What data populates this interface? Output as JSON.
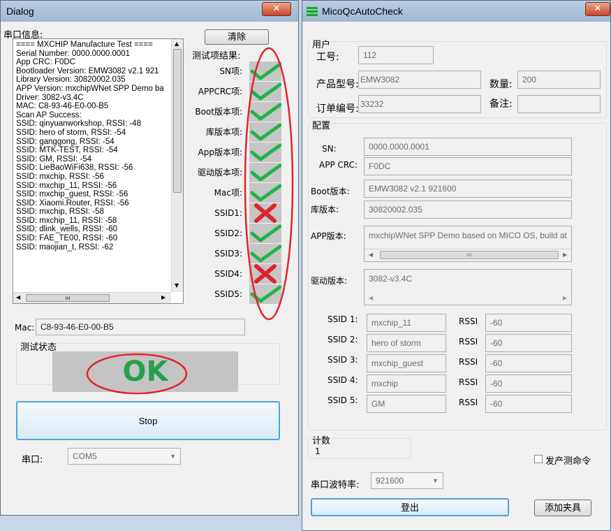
{
  "left": {
    "title": "Dialog",
    "serial_label": "串口信息:",
    "clear_button": "清除",
    "log_lines": [
      "==== MXCHIP Manufacture Test ====",
      "Serial Number: 0000.0000.0001",
      "App CRC: F0DC",
      "Bootloader Version: EMW3082 v2.1 921",
      "Library Version: 30820002.035",
      "APP Version: mxchipWNet SPP Demo ba",
      "Driver: 3082-v3.4C",
      "MAC: C8-93-46-E0-00-B5",
      "Scan AP Success:",
      "  SSID: qinyuanworkshop, RSSI: -48",
      "  SSID: hero of storm, RSSI: -54",
      "  SSID: ganggong, RSSI: -54",
      "  SSID: MTK-TEST, RSSI: -54",
      "  SSID: GM, RSSI: -54",
      "  SSID: LieBaoWiFi638, RSSI: -56",
      "  SSID: mxchip, RSSI: -56",
      "  SSID: mxchip_11, RSSI: -56",
      "  SSID: mxchip_guest, RSSI: -56",
      "  SSID: Xiaomi.Router, RSSI: -56",
      "  SSID: mxchip, RSSI: -58",
      "  SSID: mxchip_11, RSSI: -58",
      "  SSID: dlink_wells, RSSI: -60",
      "  SSID: FAE_TE00, RSSI: -60",
      "  SSID: maojian_t, RSSI: -62"
    ],
    "results_label": "测试项结果:",
    "results": [
      {
        "label": "SN项:",
        "pass": true
      },
      {
        "label": "APPCRC项:",
        "pass": true
      },
      {
        "label": "Boot版本项:",
        "pass": true
      },
      {
        "label": "库版本项:",
        "pass": true
      },
      {
        "label": "App版本项:",
        "pass": true
      },
      {
        "label": "驱动版本项:",
        "pass": true
      },
      {
        "label": "Mac项:",
        "pass": true
      },
      {
        "label": "SSID1:",
        "pass": false
      },
      {
        "label": "SSID2:",
        "pass": true
      },
      {
        "label": "SSID3:",
        "pass": true
      },
      {
        "label": "SSID4:",
        "pass": false
      },
      {
        "label": "SSID5:",
        "pass": true
      }
    ],
    "mac_label": "Mac:",
    "mac_value": "C8-93-46-E0-00-B5",
    "status_group": "测试状态",
    "status_text": "OK",
    "stop_button": "Stop",
    "port_label": "串口:",
    "port_value": "COM5",
    "scroll_thumb": "ııı"
  },
  "right": {
    "title": "MicoQcAutoCheck",
    "user_group": "用户",
    "worker_label": "工号:",
    "worker_value": "112",
    "model_label": "产品型号:",
    "model_value": "EMW3082",
    "qty_label": "数量:",
    "qty_value": "200",
    "order_label": "订单编号:",
    "order_value": "33232",
    "note_label": "备注:",
    "note_value": "",
    "config_group": "配置",
    "sn_label": "SN:",
    "sn_value": "0000.0000.0001",
    "crc_label": "APP CRC:",
    "crc_value": "F0DC",
    "boot_label": "Boot版本:",
    "boot_value": "EMW3082 v2.1 921600",
    "lib_label": "库版本:",
    "lib_value": "30820002.035",
    "app_label": "APP版本:",
    "app_value": "mxchipWNet SPP Demo based on MICO OS, build at",
    "driver_label": "驱动版本:",
    "driver_value": "3082-v3.4C",
    "scroll_thumb": "ııı",
    "rssi_label": "RSSI",
    "ssids": [
      {
        "label": "SSID 1:",
        "name": "mxchip_11",
        "rssi": "-60"
      },
      {
        "label": "SSID 2:",
        "name": "hero of storm",
        "rssi": "-60"
      },
      {
        "label": "SSID 3:",
        "name": "mxchip_guest",
        "rssi": "-60"
      },
      {
        "label": "SSID 4:",
        "name": "mxchip",
        "rssi": "-60"
      },
      {
        "label": "SSID 5:",
        "name": "GM",
        "rssi": "-60"
      }
    ],
    "count_group": "计数",
    "count_value": "1",
    "prod_cmd_label": "发产测命令",
    "baud_label": "串口波特率:",
    "baud_value": "921600",
    "logout_button": "登出",
    "add_fixture_button": "添加夹具"
  }
}
